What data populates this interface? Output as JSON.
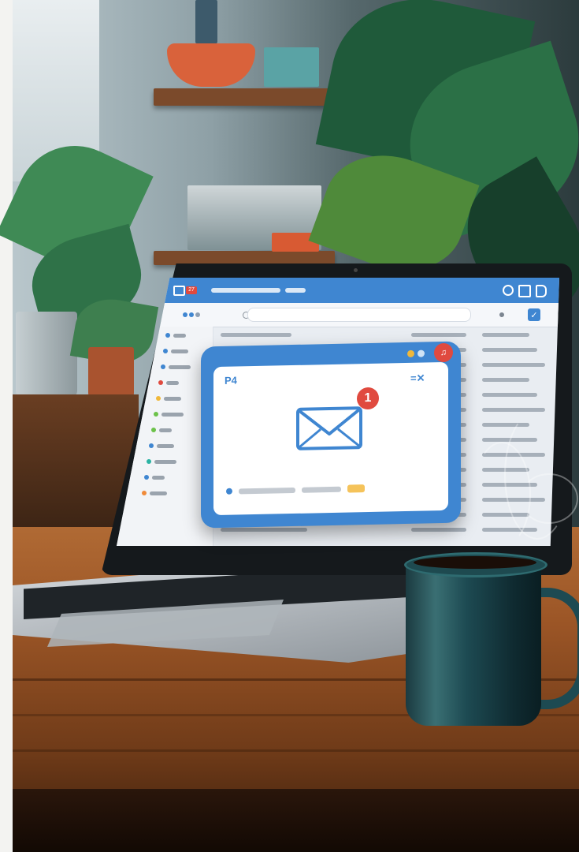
{
  "scene": {
    "palette": {
      "wall": "#8ea0a6",
      "shelf": "#7b4a2b",
      "desk": "#9b5526",
      "accent": "#3f86d1",
      "badge": "#e04a3f",
      "mug": "#1d4a52"
    }
  },
  "laptop_screen": {
    "tab_badge": "27",
    "sidebar_dot_colors": [
      "#3f86d1",
      "#3f86d1",
      "#3f86d1",
      "#e04a3f",
      "#f0b83a",
      "#6cc24a",
      "#6cc24a",
      "#3f86d1",
      "#2bb3a3",
      "#3f86d1",
      "#f08a3a"
    ]
  },
  "notification": {
    "badge_count": "1",
    "app_mark": "P4",
    "close_mark": "=✕"
  }
}
